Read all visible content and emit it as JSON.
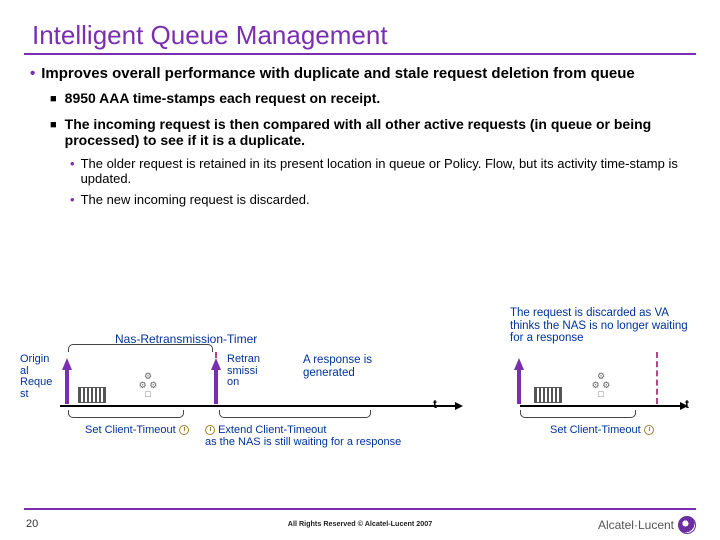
{
  "title": "Intelligent Queue Management",
  "bullets": {
    "l1": "Improves overall performance with duplicate and stale request deletion from queue",
    "l2a": "8950 AAA time-stamps each request on receipt.",
    "l2b": "The incoming request is then compared with all other active requests (in queue or being processed) to see if it is a duplicate.",
    "l3a": "The older request is retained in its present location in queue or Policy. Flow, but its activity time-stamp is updated.",
    "l3b": "The new incoming request is discarded."
  },
  "diagram": {
    "nas_timer": "Nas-Retransmission-Timer",
    "original": "Origin\nal\nReque\nst",
    "retrans": "Retran\nsmissi\non",
    "response": "A response is generated",
    "discarded": "The request is discarded as VA thinks the NAS is no longer waiting for a response",
    "set_client_1": "Set Client-Timeout",
    "extend_client": "Extend Client-Timeout\nas the NAS is still waiting for a response",
    "set_client_2": "Set Client-Timeout",
    "t": "t"
  },
  "footer": {
    "page": "20",
    "copyright": "All Rights Reserved © Alcatel-Lucent 2007",
    "brand": "Alcatel·Lucent"
  }
}
